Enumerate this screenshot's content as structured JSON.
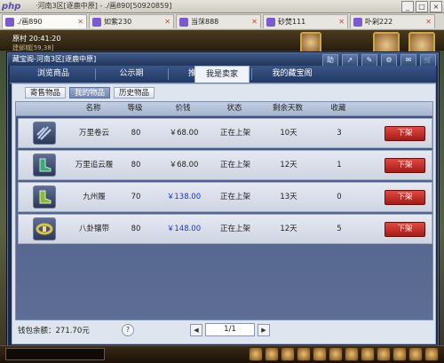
{
  "browser": {
    "title": "·河南3区[逐鹿中原] - ./画890[50920859]",
    "tabs": [
      {
        "label": "./画890",
        "active": true
      },
      {
        "label": "如紫230",
        "active": false
      },
      {
        "label": "当莯888",
        "active": false
      },
      {
        "label": "砂焚111",
        "active": false
      },
      {
        "label": "卟剁222",
        "active": false
      }
    ]
  },
  "hud": {
    "time": "原村  20:41:20",
    "info": "建邺城[59,38]"
  },
  "dialog": {
    "title": "藏宝阁-河南3区[逐鹿中原]",
    "icons": [
      "助",
      "share-icon",
      "edit-icon",
      "gear-icon",
      "mail-icon",
      "cart-icon"
    ],
    "nav": [
      {
        "label": "浏览商品",
        "active": false
      },
      {
        "label": "公示期",
        "active": false
      },
      {
        "label": "推荐商品",
        "active": false
      },
      {
        "label": "我是卖家",
        "active": true
      },
      {
        "label": "我的藏宝阁",
        "active": false
      }
    ],
    "subtabs": [
      {
        "label": "寄售物品",
        "active": false
      },
      {
        "label": "我的物品",
        "active": true
      },
      {
        "label": "历史物品",
        "active": false
      }
    ],
    "columns": [
      "名称",
      "等级",
      "价钱",
      "状态",
      "剩余天数",
      "收藏"
    ],
    "rows": [
      {
        "icon": "claw-weapon-icon",
        "name": "万里卷云",
        "level": "80",
        "price": "￥68.00",
        "price_blue": false,
        "status": "正在上架",
        "days": "10天",
        "fav": "3",
        "action": "下架"
      },
      {
        "icon": "boots-icon",
        "name": "万里追云履",
        "level": "80",
        "price": "￥68.00",
        "price_blue": false,
        "status": "正在上架",
        "days": "12天",
        "fav": "1",
        "action": "下架"
      },
      {
        "icon": "boots-icon",
        "name": "九州履",
        "level": "70",
        "price": "￥138.00",
        "price_blue": true,
        "status": "正在上架",
        "days": "13天",
        "fav": "0",
        "action": "下架"
      },
      {
        "icon": "belt-icon",
        "name": "八卦镶带",
        "level": "80",
        "price": "￥148.00",
        "price_blue": true,
        "status": "正在上架",
        "days": "12天",
        "fav": "5",
        "action": "下架"
      }
    ],
    "footer": {
      "wallet": "钱包余额：271.70元",
      "help": "?",
      "page": "1/1"
    }
  }
}
